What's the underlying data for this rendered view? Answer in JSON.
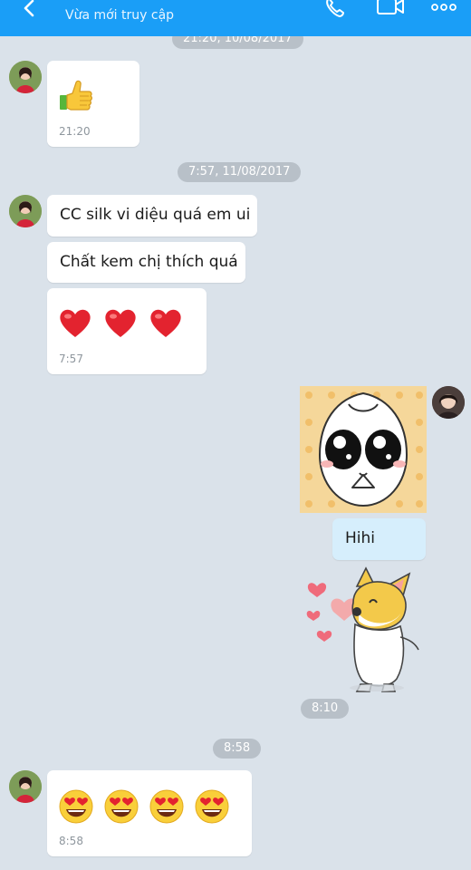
{
  "header": {
    "status": "Vừa mới truy cập",
    "icons": {
      "back": "back-arrow-icon",
      "call": "phone-icon",
      "video": "video-call-icon",
      "more": "more-dots-icon"
    },
    "accent_color": "#1a9ef7"
  },
  "conversation": {
    "timestamps": [
      {
        "label": "21:20, 10/08/2017"
      },
      {
        "label": "7:57, 11/08/2017"
      },
      {
        "label": "8:10"
      },
      {
        "label": "8:58"
      }
    ],
    "messages": [
      {
        "side": "left",
        "type": "emoji",
        "emoji": "thumbs-up",
        "time": "21:20"
      },
      {
        "side": "left",
        "type": "text",
        "text": "CC silk vi diệu quá em ui"
      },
      {
        "side": "left",
        "type": "text",
        "text": "Chất kem chị thích quá"
      },
      {
        "side": "left",
        "type": "emoji",
        "emoji": "red-heart x3",
        "time": "7:57"
      },
      {
        "side": "right",
        "type": "sticker",
        "sticker": "pleading-dumpling-sticker"
      },
      {
        "side": "right",
        "type": "text",
        "text": "Hihi"
      },
      {
        "side": "right",
        "type": "sticker",
        "sticker": "kissing-dog-hearts-sticker"
      },
      {
        "side": "left",
        "type": "emoji",
        "emoji": "heart-eyes x4",
        "time": "8:58"
      }
    ]
  }
}
